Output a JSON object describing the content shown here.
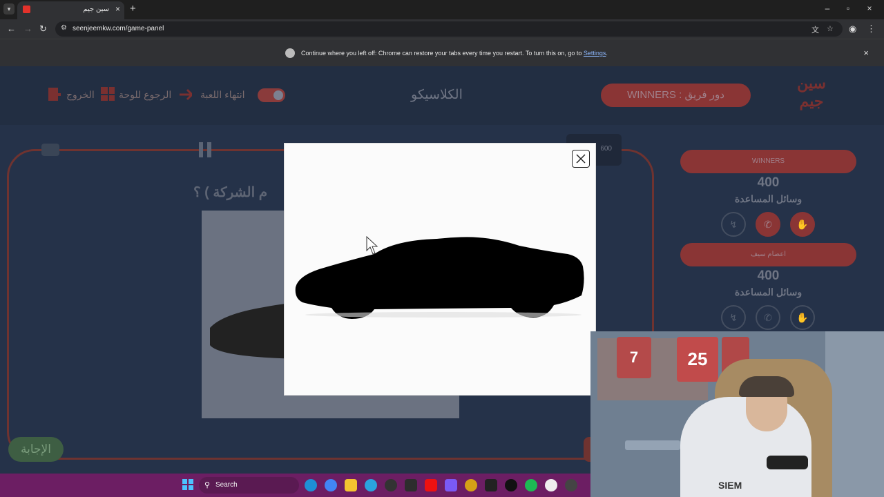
{
  "browser": {
    "tab_title": "سين جيم",
    "url": "seenjeemkw.com/game-panel",
    "infobar_text": "Continue where you left off: Chrome can restore your tabs every time you restart. To turn this on, go to ",
    "infobar_link": "Settings",
    "infobar_period": "."
  },
  "game": {
    "header": {
      "exit_label": "الخروج",
      "back_to_board_label": "الرجوع للوحة",
      "end_game_label": "انتهاء اللعبة",
      "category_title": "الكلاسيكو",
      "turn_label": "دور فريق : WINNERS",
      "logo_text": "سين جيم"
    },
    "score_chip": "600",
    "question_text": "م الشركة ) ؟",
    "answer_button": "الإجابة",
    "teams": [
      {
        "name": "WINNERS",
        "score": "400",
        "aids_label": "وسائل المساعدة"
      },
      {
        "name": "اعضام سيف",
        "score": "400",
        "aids_label": "وسائل المساعدة"
      }
    ]
  },
  "webcam": {
    "jersey_number_1": "7",
    "jersey_number_2": "25",
    "shirt_text": "SIEM"
  },
  "taskbar": {
    "search_placeholder": "Search"
  }
}
